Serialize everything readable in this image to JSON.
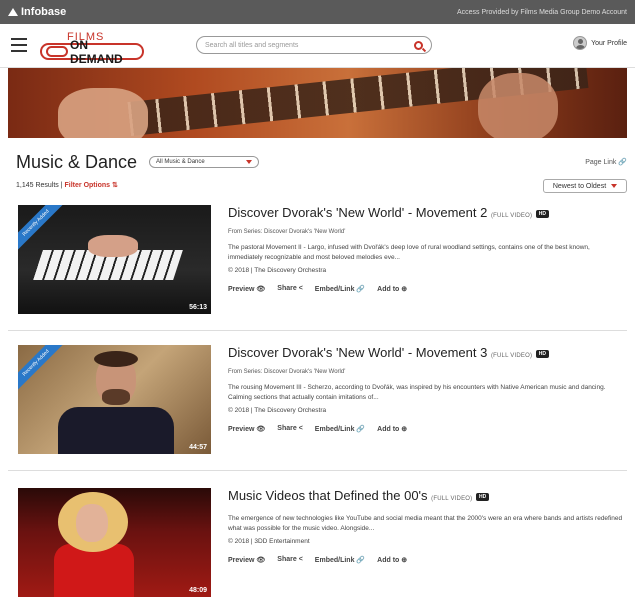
{
  "topbar": {
    "brand": "Infobase",
    "access": "Access Provided by Films Media Group Demo Account"
  },
  "header": {
    "brand_top": "FILMS",
    "brand_bottom": "ON DEMAND",
    "search_placeholder": "Search all titles and segments",
    "profile_label": "Your Profile"
  },
  "page": {
    "title": "Music & Dance",
    "category_select": "All Music & Dance",
    "page_link": "Page Link 🔗",
    "results_count": "1,145 Results | ",
    "filter_label": "Filter Options ⇅",
    "sort_label": "Newest to Oldest"
  },
  "items": [
    {
      "title": "Discover Dvorak's 'New World' - Movement 2",
      "video_tag": "(FULL VIDEO)",
      "hd": "HD",
      "ribbon": "Recently Added",
      "series": "From Series: Discover Dvorak's 'New World'",
      "description": "The pastoral Movement II - Largo, infused with Dvořák's deep love of rural woodland settings, contains one of the best known, immediately recognizable and most beloved melodies eve...",
      "meta": "© 2018 | The Discovery Orchestra",
      "duration": "56:13",
      "actions": [
        "Preview 👁",
        "Share <",
        "Embed/Link 🔗",
        "Add to ⊕"
      ]
    },
    {
      "title": "Discover Dvorak's 'New World' - Movement 3",
      "video_tag": "(FULL VIDEO)",
      "hd": "HD",
      "ribbon": "Recently Added",
      "series": "From Series: Discover Dvorak's 'New World'",
      "description": "The rousing Movement III - Scherzo, according to Dvořák, was inspired by his encounters with Native American music and dancing. Calming sections that actually contain imitations of...",
      "meta": "© 2018 | The Discovery Orchestra",
      "duration": "44:57",
      "actions": [
        "Preview 👁",
        "Share <",
        "Embed/Link 🔗",
        "Add to ⊕"
      ]
    },
    {
      "title": "Music Videos that Defined the 00's",
      "video_tag": "(FULL VIDEO)",
      "hd": "HD",
      "description": "The emergence of new technologies like YouTube and social media meant that the 2000's were an era where bands and artists redefined what was possible for the music video. Alongside...",
      "meta": "© 2018 | 3DD Entertainment",
      "duration": "48:09",
      "actions": [
        "Preview 👁",
        "Share <",
        "Embed/Link 🔗",
        "Add to ⊕"
      ]
    }
  ]
}
